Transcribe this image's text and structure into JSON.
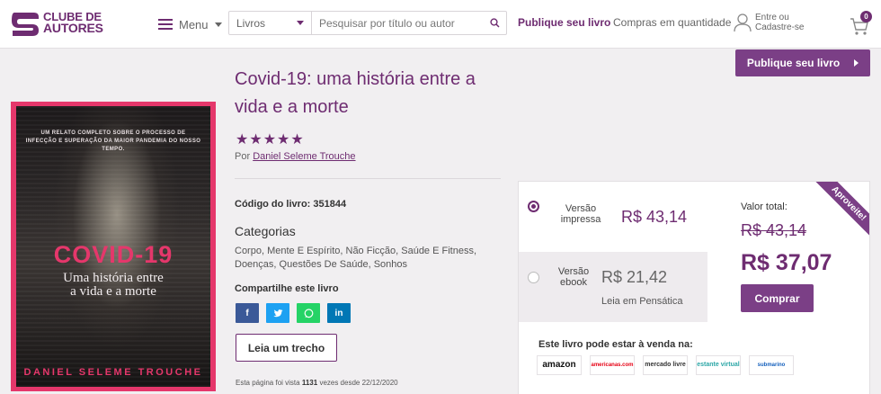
{
  "header": {
    "logo_line1": "CLUBE DE",
    "logo_line2": "AUTORES",
    "menu_label": "Menu",
    "search_category": "Livros",
    "search_placeholder": "Pesquisar por título ou autor",
    "nav_publish": "Publique seu livro",
    "nav_bulk": "Compras em quantidade",
    "account_line1": "Entre ou",
    "account_line2": "Cadastre-se",
    "cart_count": "0"
  },
  "publish_button": "Publique seu livro",
  "cover": {
    "tagline": "UM RELATO COMPLETO SOBRE O PROCESSO DE INFECÇÃO E SUPERAÇÃO DA MAIOR PANDEMIA DO NOSSO TEMPO.",
    "title": "COVID-19",
    "subtitle_line1": "Uma história entre",
    "subtitle_line2": "a vida e a morte",
    "author": "DANIEL SELEME TROUCHE"
  },
  "book": {
    "title": "Covid-19: uma história entre a vida e a morte",
    "rating": 5,
    "by_label": "Por",
    "author": "Daniel Seleme Trouche",
    "code_label": "Código do livro:",
    "code": "351844",
    "categories_heading": "Categorias",
    "categories": "Corpo, Mente E Espírito, Não Ficção, Saúde E Fitness, Doenças, Questões De Saúde, Sonhos",
    "share_heading": "Compartilhe este livro",
    "read_button": "Leia um trecho",
    "views_prefix": "Esta página foi vista",
    "views_count": "1131",
    "views_suffix": "vezes desde 22/12/2020"
  },
  "share": [
    "f",
    "t",
    "w",
    "in"
  ],
  "share_colors": {
    "facebook": "#3b5998",
    "twitter": "#1da1f2",
    "whatsapp": "#25d366",
    "linkedin": "#0077b5"
  },
  "buy": {
    "print_label_line1": "Versão",
    "print_label_line2": "impressa",
    "print_price": "R$ 43,14",
    "ebook_label_line1": "Versão",
    "ebook_label_line2": "ebook",
    "ebook_price": "R$ 21,42",
    "ebook_sub": "Leia em Pensática",
    "total_label": "Valor total:",
    "old_price": "R$ 43,14",
    "new_price": "R$ 37,07",
    "buy_button": "Comprar",
    "ribbon": "Aproveite!",
    "stores_heading": "Este livro pode estar à venda na:",
    "stores": [
      "amazon",
      "americanas.com",
      "mercado livre",
      "estante virtual",
      "submarino"
    ]
  },
  "colors": {
    "brand": "#6e2c71",
    "button": "#7b3f86",
    "cover_accent": "#e5376b"
  }
}
